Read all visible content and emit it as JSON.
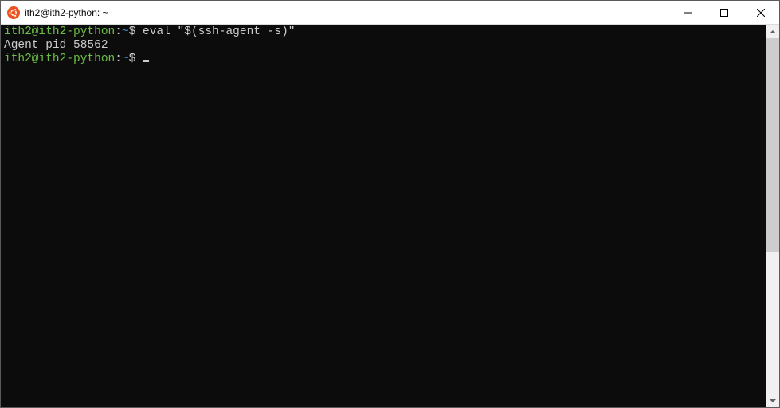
{
  "window": {
    "title": "ith2@ith2-python: ~"
  },
  "terminal": {
    "lines": [
      {
        "prompt": {
          "user_host": "ith2@ith2-python",
          "colon": ":",
          "path": "~",
          "dollar": "$ "
        },
        "command": "eval \"$(ssh-agent -s)\""
      },
      {
        "output": "Agent pid 58562"
      },
      {
        "prompt": {
          "user_host": "ith2@ith2-python",
          "colon": ":",
          "path": "~",
          "dollar": "$ "
        },
        "command": "",
        "cursor": true
      }
    ]
  }
}
